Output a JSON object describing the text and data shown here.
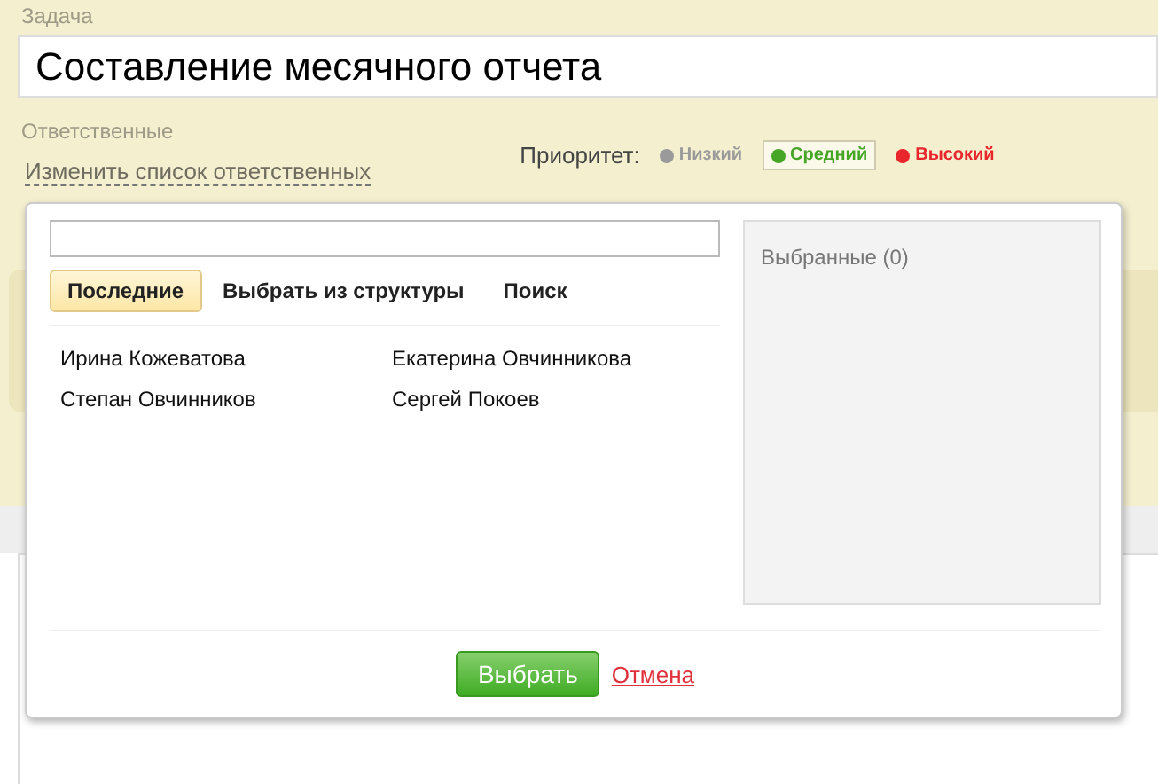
{
  "task": {
    "label": "Задача",
    "value": "Составление месячного отчета"
  },
  "responsible": {
    "label": "Ответственные",
    "link": "Изменить список ответственных"
  },
  "priority": {
    "label": "Приоритет:",
    "options": [
      {
        "label": "Низкий",
        "color": "#9a9a9a",
        "selected": false
      },
      {
        "label": "Средний",
        "color": "#44a624",
        "selected": true
      },
      {
        "label": "Высокий",
        "color": "#e8262c",
        "selected": false
      }
    ]
  },
  "dialog": {
    "tabs": [
      {
        "label": "Последние",
        "selected": true
      },
      {
        "label": "Выбрать из структуры",
        "selected": false
      },
      {
        "label": "Поиск",
        "selected": false
      }
    ],
    "people": [
      "Ирина Кожеватова",
      "Екатерина Овчинникова",
      "Степан Овчинников",
      "Сергей Покоев"
    ],
    "selected_title": "Выбранные (0)",
    "buttons": {
      "ok": "Выбрать",
      "cancel": "Отмена"
    }
  }
}
